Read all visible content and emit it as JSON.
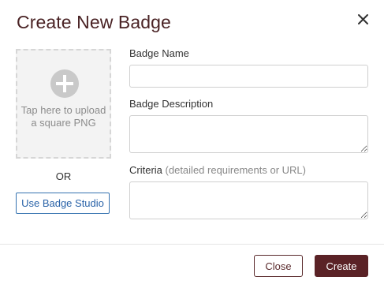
{
  "dialog": {
    "title": "Create New Badge"
  },
  "upload": {
    "hint": "Tap here to upload a square PNG",
    "or_text": "OR",
    "studio_button": "Use Badge Studio"
  },
  "form": {
    "name_label": "Badge Name",
    "name_value": "",
    "description_label": "Badge Description",
    "description_value": "",
    "criteria_label": "Criteria",
    "criteria_hint": "(detailed requirements or URL)",
    "criteria_value": ""
  },
  "footer": {
    "close_label": "Close",
    "create_label": "Create"
  },
  "colors": {
    "brand": "#5a2226",
    "link": "#3572b0"
  },
  "icons": {
    "close": "close-icon",
    "upload": "plus-circle-icon"
  }
}
